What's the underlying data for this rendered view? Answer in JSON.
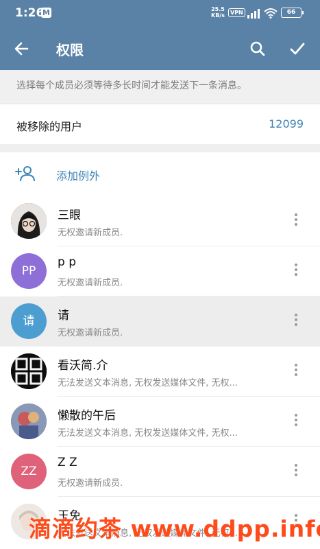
{
  "statusbar": {
    "time": "1:26",
    "app_badge": "M",
    "net_speed_value": "25.5",
    "net_speed_unit": "KB/s",
    "vpn": "VPN",
    "battery": "66"
  },
  "toolbar": {
    "title": "权限",
    "back_icon": "arrow-left-icon",
    "search_icon": "search-icon",
    "confirm_icon": "check-icon"
  },
  "hint": "选择每个成员必须等待多长时间才能发送下一条消息。",
  "removed_users": {
    "label": "被移除的用户",
    "count": "12099"
  },
  "add_exception": {
    "label": "添加例外",
    "icon": "add-user-icon"
  },
  "members": [
    {
      "name": "三眼",
      "status": "无权邀请新成员.",
      "avatar_text": "",
      "avatar_color": "#444444"
    },
    {
      "name": "p p",
      "status": "无权邀请新成员.",
      "avatar_text": "PP",
      "avatar_color": "#8e6fd8"
    },
    {
      "name": "请",
      "status": "无权邀请新成员.",
      "avatar_text": "请",
      "avatar_color": "#4c9ed0"
    },
    {
      "name": "看沃简.介",
      "status": "无法发送文本消息, 无权发送媒体文件, 无权...",
      "avatar_text": "",
      "avatar_color": "#111111"
    },
    {
      "name": "懒散的午后",
      "status": "无法发送文本消息, 无权发送媒体文件, 无权...",
      "avatar_text": "",
      "avatar_color": "#7a6a8a"
    },
    {
      "name": "Z Z",
      "status": "无权邀请新成员.",
      "avatar_text": "ZZ",
      "avatar_color": "#e0617a"
    },
    {
      "name": "王免",
      "status": "无法发送文本消息, 无权发送媒体文件, 无权...",
      "avatar_text": "",
      "avatar_color": "#d9d2cc"
    }
  ],
  "watermark": "滴滴约茶 www.ddpp.info",
  "colors": {
    "header": "#5a82a6",
    "accent": "#3e84b7"
  }
}
